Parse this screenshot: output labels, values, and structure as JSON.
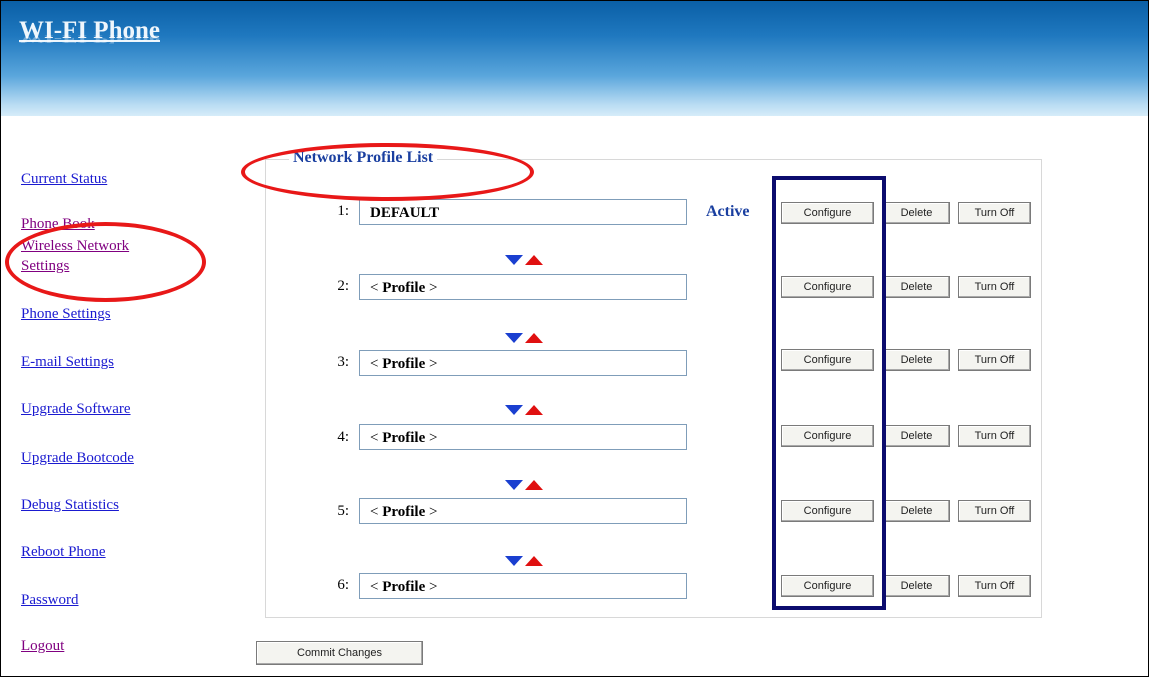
{
  "app": {
    "title": "WI-FI Phone"
  },
  "sidebar": {
    "items": [
      {
        "label": "Current Status"
      },
      {
        "label": "Phone Book"
      },
      {
        "label": "Wireless Network",
        "label2": "Settings"
      },
      {
        "label": "Phone Settings"
      },
      {
        "label": "E-mail Settings"
      },
      {
        "label": "Upgrade Software"
      },
      {
        "label": "Upgrade Bootcode"
      },
      {
        "label": "Debug Statistics"
      },
      {
        "label": "Reboot Phone"
      },
      {
        "label": "Password"
      },
      {
        "label": "Logout"
      }
    ]
  },
  "main": {
    "section_title": "Network Profile List",
    "active_label": "Active",
    "configure_label": "Configure",
    "delete_label": "Delete",
    "turn_off_label": "Turn Off",
    "commit_label": "Commit Changes",
    "profiles": [
      {
        "num": "1:",
        "name": "DEFAULT"
      },
      {
        "num": "2:",
        "prefix": "< ",
        "name": "Profile",
        "suffix": " >"
      },
      {
        "num": "3:",
        "prefix": "< ",
        "name": "Profile",
        "suffix": " >"
      },
      {
        "num": "4:",
        "prefix": "< ",
        "name": "Profile",
        "suffix": " >"
      },
      {
        "num": "5:",
        "prefix": "< ",
        "name": "Profile",
        "suffix": " >"
      },
      {
        "num": "6:",
        "prefix": "< ",
        "name": "Profile",
        "suffix": " >"
      }
    ]
  },
  "colors": {
    "highlight_ellipse": "#e81818",
    "highlight_box": "#0c0c6e",
    "link": "#1a1ad0",
    "visited_link": "#800080",
    "move_down_arrow": "#1a3fd0",
    "move_up_arrow": "#e01010"
  }
}
